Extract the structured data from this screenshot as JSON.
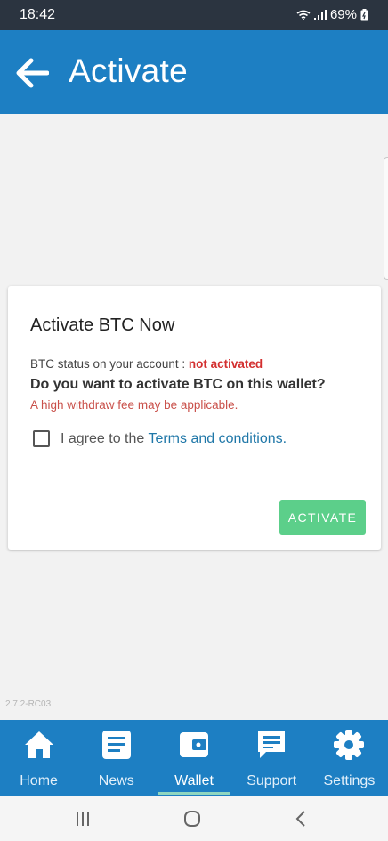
{
  "status_bar": {
    "time": "18:42",
    "battery": "69%"
  },
  "header": {
    "title": "Activate"
  },
  "card": {
    "title": "Activate BTC Now",
    "status_label": "BTC status on your account : ",
    "status_value": "not activated",
    "question": "Do you want to activate BTC on this wallet?",
    "fee_warning": "A high withdraw fee may be applicable.",
    "agree_prefix": "I agree to the ",
    "terms_link": "Terms and conditions.",
    "activate_label": "ACTIVATE"
  },
  "version": "2.7.2-RC03",
  "nav": {
    "items": [
      {
        "label": "Home",
        "icon": "home-icon"
      },
      {
        "label": "News",
        "icon": "news-icon"
      },
      {
        "label": "Wallet",
        "icon": "wallet-icon",
        "active": true
      },
      {
        "label": "Support",
        "icon": "support-icon"
      },
      {
        "label": "Settings",
        "icon": "settings-icon"
      }
    ]
  },
  "colors": {
    "primary": "#1d7fc3",
    "activate_button": "#5ccf8a",
    "status_red": "#d32f2f",
    "link": "#1f77a8"
  }
}
